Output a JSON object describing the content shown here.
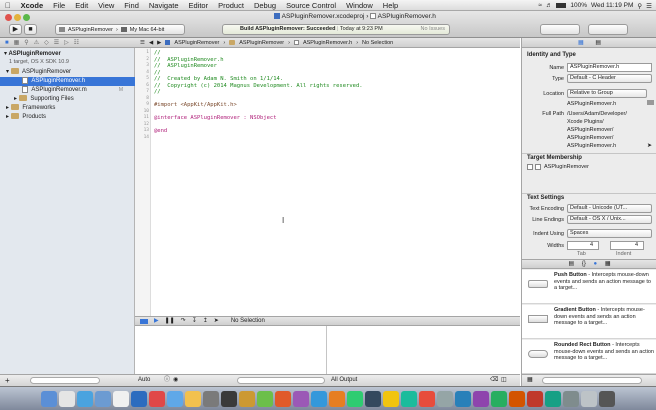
{
  "menubar": {
    "apple": "",
    "app": "Xcode",
    "items": [
      "File",
      "Edit",
      "View",
      "Find",
      "Navigate",
      "Editor",
      "Product",
      "Debug",
      "Source Control",
      "Window",
      "Help"
    ],
    "battery": "100%",
    "clock": "Wed 11:19 PM"
  },
  "toolbar": {
    "scheme": "ASPluginRemover",
    "destination": "My Mac 64-bit",
    "activity_status": "Build ASPluginRemover: Succeeded",
    "activity_time": "Today at 9:23 PM",
    "activity_issues": "No Issues"
  },
  "tabs": {
    "project_tab": "ASPluginRemover.xcodeproj",
    "file_tab": "ASPluginRemover.h"
  },
  "navigator": {
    "project_name": "ASPluginRemover",
    "project_subtitle": "1 target, OS X SDK 10.9",
    "group": "ASPluginRemover",
    "files": [
      "ASPluginRemover.h",
      "ASPluginRemover.m"
    ],
    "m_badge": "M",
    "subgroup": "Supporting Files",
    "frameworks": "Frameworks",
    "products": "Products"
  },
  "jumpbar": {
    "project": "ASPluginRemover",
    "group": "ASPluginRemover",
    "file": "ASPluginRemover.h",
    "selection": "No Selection"
  },
  "code": {
    "line_numbers": [
      "1",
      "2",
      "3",
      "4",
      "5",
      "6",
      "7",
      "8",
      "9",
      "10",
      "11",
      "12",
      "13",
      "14"
    ],
    "lines": [
      "//",
      "//  ASPluginRemover.h",
      "//  ASPluginRemover",
      "//",
      "//  Created by Adam N. Smith on 1/1/14.",
      "//  Copyright (c) 2014 Magnus Development. All rights reserved.",
      "//",
      "",
      "#import <AppKit/AppKit.h>",
      "",
      "@interface ASPluginRemover : NSObject",
      "",
      "@end",
      ""
    ]
  },
  "debug": {
    "selection": "No Selection",
    "auto_label": "Auto",
    "output_label": "All Output"
  },
  "inspector": {
    "identity_header": "Identity and Type",
    "name_label": "Name",
    "name_value": "ASPluginRemover.h",
    "type_label": "Type",
    "type_value": "Default - C Header",
    "location_label": "Location",
    "location_value": "Relative to Group",
    "location_file": "ASPluginRemover.h",
    "fullpath_label": "Full Path",
    "fullpath_lines": [
      "/Users/Adam/Developer/",
      "Xcode Plugins/",
      "ASPluginRemover/",
      "ASPluginRemover/",
      "ASPluginRemover.h"
    ],
    "membership_header": "Target Membership",
    "membership_target": "ASPluginRemover",
    "text_settings_header": "Text Settings",
    "encoding_label": "Text Encoding",
    "encoding_value": "Default - Unicode (UT...",
    "endings_label": "Line Endings",
    "endings_value": "Default - OS X / Unix...",
    "indent_label": "Indent Using",
    "indent_value": "Spaces",
    "widths_label": "Widths",
    "tab_width": "4",
    "indent_width": "4",
    "tab_caption": "Tab",
    "indent_caption": "Indent"
  },
  "library": [
    {
      "name": "Push Button",
      "desc": "- Intercepts mouse-down events and sends an action message to a target..."
    },
    {
      "name": "Gradient Button",
      "desc": "- Intercepts mouse-down events and sends an action message to a target..."
    },
    {
      "name": "Rounded Rect Button",
      "desc": "- Intercepts mouse-down events and sends an action message to a target..."
    }
  ],
  "dock_colors": [
    "#5b8fd6",
    "#e5e5e5",
    "#4aa3df",
    "#6c9bd2",
    "#f0f0f0",
    "#2c6cbf",
    "#e04848",
    "#5fa8e8",
    "#f2c14e",
    "#7a7a7a",
    "#3a3a3a",
    "#c93",
    "#6cbf4a",
    "#e05a2a",
    "#9b59b6",
    "#3498db",
    "#e67e22",
    "#2ecc71",
    "#34495e",
    "#f1c40f",
    "#1abc9c",
    "#e74c3c",
    "#95a5a6",
    "#2980b9",
    "#8e44ad",
    "#27ae60",
    "#d35400",
    "#c0392b",
    "#16a085",
    "#7f8c8d",
    "#bdc3c7",
    "#555"
  ]
}
